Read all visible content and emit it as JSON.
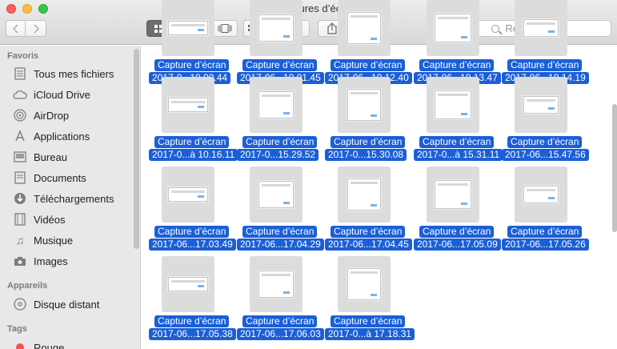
{
  "window": {
    "title": "Captures d’écran",
    "search_placeholder": "Rechercher"
  },
  "sidebar": {
    "favorites_header": "Favoris",
    "favorites": [
      {
        "label": "Tous mes fichiers",
        "icon": "all-files-icon"
      },
      {
        "label": "iCloud Drive",
        "icon": "cloud-icon"
      },
      {
        "label": "AirDrop",
        "icon": "airdrop-icon"
      },
      {
        "label": "Applications",
        "icon": "applications-icon"
      },
      {
        "label": "Bureau",
        "icon": "desktop-icon"
      },
      {
        "label": "Documents",
        "icon": "documents-icon"
      },
      {
        "label": "Téléchargements",
        "icon": "download-icon"
      },
      {
        "label": "Vidéos",
        "icon": "film-icon"
      },
      {
        "label": "Musique",
        "icon": "music-icon"
      },
      {
        "label": "Images",
        "icon": "camera-icon"
      }
    ],
    "devices_header": "Appareils",
    "devices": [
      {
        "label": "Disque distant",
        "icon": "disc-icon"
      }
    ],
    "tags_header": "Tags",
    "tags": [
      {
        "label": "Rouge",
        "color": "#fc4c4c"
      }
    ]
  },
  "files": {
    "row0": [
      {
        "name1": "Capture d’écran",
        "name2": "2017-0...10.00.44"
      },
      {
        "name1": "Capture d’écran",
        "name2": "2017-06...10.01.45"
      },
      {
        "name1": "Capture d’écran",
        "name2": "2017-06...10.12.40"
      },
      {
        "name1": "Capture d’écran",
        "name2": "2017-06...10.13.47"
      },
      {
        "name1": "Capture d’écran",
        "name2": "2017-06...10.14.19"
      }
    ],
    "row1": [
      {
        "name1": "Capture d’écran",
        "name2": "2017-0...à 10.16.11"
      },
      {
        "name1": "Capture d’écran",
        "name2": "2017-0...15.29.52"
      },
      {
        "name1": "Capture d’écran",
        "name2": "2017-0...15.30.08"
      },
      {
        "name1": "Capture d’écran",
        "name2": "2017-0...à 15.31.11"
      },
      {
        "name1": "Capture d’écran",
        "name2": "2017-06...15.47.56"
      }
    ],
    "row2": [
      {
        "name1": "Capture d’écran",
        "name2": "2017-06...17.03.49"
      },
      {
        "name1": "Capture d’écran",
        "name2": "2017-06...17.04.29"
      },
      {
        "name1": "Capture d’écran",
        "name2": "2017-06...17.04.45"
      },
      {
        "name1": "Capture d’écran",
        "name2": "2017-06...17.05.09"
      },
      {
        "name1": "Capture d’écran",
        "name2": "2017-06...17.05.26"
      }
    ],
    "row3": [
      {
        "name1": "Capture d’écran",
        "name2": "2017-06...17.05.38"
      },
      {
        "name1": "Capture d’écran",
        "name2": "2017-06...17.06.03"
      },
      {
        "name1": "Capture d’écran",
        "name2": "2017-0...à 17.18.31"
      }
    ]
  }
}
